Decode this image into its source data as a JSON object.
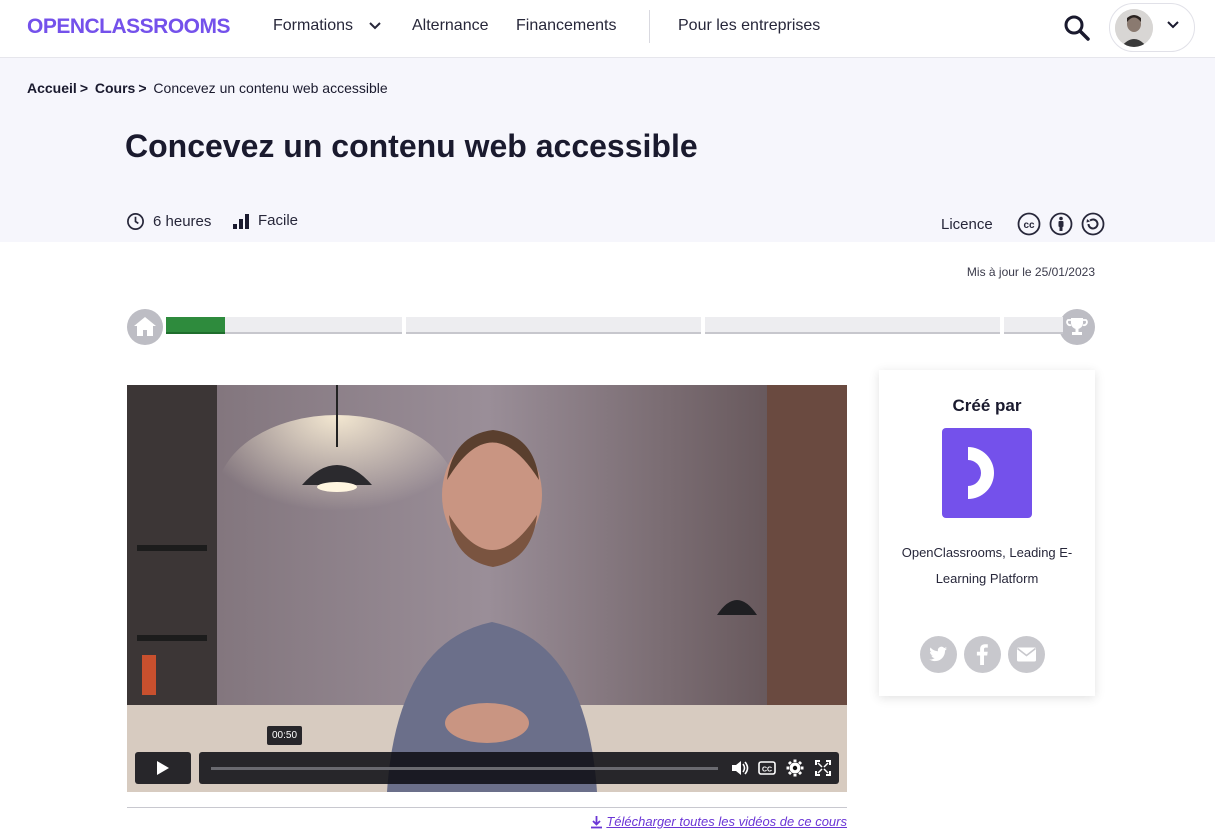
{
  "header": {
    "logo_text": "OPENCLASSROOMS",
    "nav": {
      "formations": "Formations",
      "alternance": "Alternance",
      "financements": "Financements",
      "entreprises": "Pour les entreprises"
    },
    "icons": [
      "search-icon",
      "chevron-down-icon",
      "avatar"
    ]
  },
  "breadcrumb": {
    "home": "Accueil",
    "courses": "Cours",
    "current": "Concevez un contenu web accessible",
    "separator": ">"
  },
  "course": {
    "title": "Concevez un contenu web accessible",
    "duration": "6 heures",
    "level": "Facile",
    "licence_label": "Licence",
    "licence_icons": [
      "cc-icon",
      "by-icon",
      "sa-icon"
    ],
    "updated": "Mis à jour le 25/01/2023"
  },
  "progress": {
    "parts": [
      4,
      5,
      5,
      1
    ],
    "completed_segments": 1,
    "colors": {
      "done": "#2e8b3d",
      "todo": "#ededf0"
    }
  },
  "video": {
    "time_tooltip": "00:50",
    "controls": [
      "play-icon",
      "volume-icon",
      "captions-icon",
      "settings-icon",
      "fullscreen-icon"
    ]
  },
  "download_link": "Télécharger toutes les vidéos de ce cours",
  "creator": {
    "title": "Créé par",
    "name": "OpenClassrooms, Leading E-Learning Platform",
    "share": [
      "twitter-icon",
      "facebook-icon",
      "mail-icon"
    ]
  },
  "colors": {
    "brand": "#7451eb",
    "link": "#6b35d6",
    "hero_bg": "#f6f6fc"
  }
}
